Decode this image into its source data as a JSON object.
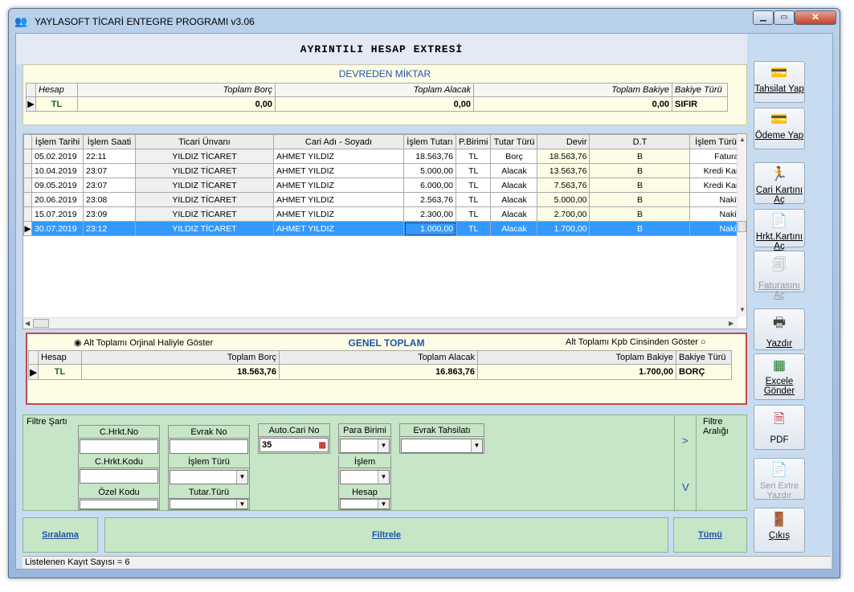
{
  "window": {
    "title": "YAYLASOFT TİCARİ ENTEGRE PROGRAMI v3.06"
  },
  "page_title": "AYRINTILI HESAP EXTRESİ",
  "devreden": {
    "title": "DEVREDEN MİKTAR",
    "headers": [
      "Hesap",
      "Toplam Borç",
      "Toplam Alacak",
      "Toplam Bakiye",
      "Bakiye Türü"
    ],
    "row": [
      "TL",
      "0,00",
      "0,00",
      "0,00",
      "SIFIR"
    ]
  },
  "grid": {
    "headers": [
      "İşlem Tarihi",
      "İşlem Saati",
      "Ticari Ünvanı",
      "Cari Adı - Soyadı",
      "İşlem Tutarı",
      "P.Birimi",
      "Tutar Türü",
      "Devir",
      "D.T",
      "İşlem  Türü"
    ],
    "rows": [
      [
        "05.02.2019",
        "22:11",
        "YILDIZ TİCARET",
        "AHMET YILDIZ",
        "18.563,76",
        "TL",
        "Borç",
        "18.563,76",
        "B",
        "Fatura"
      ],
      [
        "10.04.2019",
        "23:07",
        "YILDIZ TİCARET",
        "AHMET YILDIZ",
        "5.000,00",
        "TL",
        "Alacak",
        "13.563,76",
        "B",
        "Kredi Kar"
      ],
      [
        "09.05.2019",
        "23:07",
        "YILDIZ TİCARET",
        "AHMET YILDIZ",
        "6.000,00",
        "TL",
        "Alacak",
        "7.563,76",
        "B",
        "Kredi Kar"
      ],
      [
        "20.06.2019",
        "23:08",
        "YILDIZ TİCARET",
        "AHMET YILDIZ",
        "2.563,76",
        "TL",
        "Alacak",
        "5.000,00",
        "B",
        "Nakit"
      ],
      [
        "15.07.2019",
        "23:09",
        "YILDIZ TİCARET",
        "AHMET YILDIZ",
        "2.300,00",
        "TL",
        "Alacak",
        "2.700,00",
        "B",
        "Nakit"
      ],
      [
        "30.07.2019",
        "23:12",
        "YILDIZ TİCARET",
        "AHMET YILDIZ",
        "1.000,00",
        "TL",
        "Alacak",
        "1.700,00",
        "B",
        "Nakit"
      ]
    ]
  },
  "genel": {
    "title": "GENEL TOPLAM",
    "radio_left": "Alt Toplamı Orjinal Haliyle Göster",
    "radio_right": "Alt Toplamı Kpb Cinsinden Göster",
    "headers": [
      "Hesap",
      "Toplam Borç",
      "Toplam Alacak",
      "Toplam Bakiye",
      "Bakiye Türü"
    ],
    "row": [
      "TL",
      "18.563,76",
      "16.863,76",
      "1.700,00",
      "BORÇ"
    ]
  },
  "filter": {
    "title": "Filtre Şartı",
    "range_title": "Filtre Aralığı",
    "c_hrkt_no": "C.Hrkt.No",
    "evrak_no": "Evrak No",
    "auto_cari_no": "Auto.Cari No",
    "auto_cari_value": "35",
    "para_birimi": "Para Birimi",
    "evrak_tahsilati": "Evrak Tahsilatı",
    "c_hrkt_kodu": "C.Hrkt.Kodu",
    "islem_turu": "İşlem Türü",
    "islem": "İşlem",
    "ozel_kodu": "Özel Kodu",
    "tutar_turu": "Tutar.Türü",
    "hesap": "Hesap",
    "nav_next": ">",
    "nav_down": "V"
  },
  "bottom": {
    "siralama": "Sıralama",
    "filtrele": "Filtrele",
    "tumu": "Tümü"
  },
  "status": "Listelenen Kayıt Sayısı = 6",
  "buttons": {
    "tahsilat": "Tahsilat Yap",
    "odeme": "Ödeme Yap",
    "cari_karti": "Cari Kartını Aç",
    "hrkt_karti": "Hrkt.Kartını Aç",
    "faturasini": "Faturasını Aç",
    "yazdir": "Yazdır",
    "excele": "Excele Gönder",
    "pdf": "PDF",
    "seri_extre": "Seri Extre Yazdır",
    "cikis": "Çıkış"
  },
  "icons": [
    "users-icon",
    "minimize-icon",
    "maximize-icon",
    "close-icon",
    "card-icon",
    "payment-icon",
    "runner-icon",
    "document-icon",
    "invoice-icon",
    "printer-icon",
    "excel-icon",
    "pdf-icon",
    "door-icon"
  ]
}
